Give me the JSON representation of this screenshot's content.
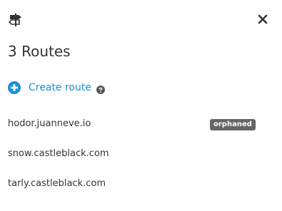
{
  "header": {
    "icon": "signpost-icon",
    "close_icon": "close-icon"
  },
  "title": "3 Routes",
  "create": {
    "icon": "plus-circle-icon",
    "label": "Create route",
    "help_icon": "question-circle-icon"
  },
  "routes": [
    {
      "host": "hodor.juanneve.io",
      "badge": "orphaned"
    },
    {
      "host": "snow.castleblack.com",
      "badge": ""
    },
    {
      "host": "tarly.castleblack.com",
      "badge": ""
    }
  ],
  "colors": {
    "accent": "#1a90d6",
    "badge_bg": "#666666",
    "text": "#333333"
  }
}
